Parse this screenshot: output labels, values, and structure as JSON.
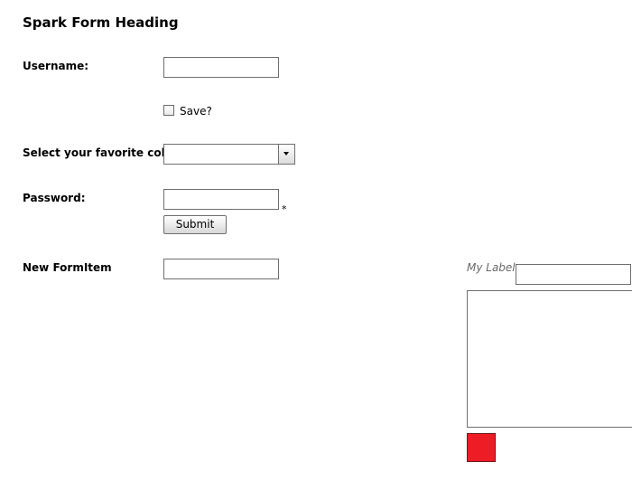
{
  "form": {
    "heading": "Spark Form Heading",
    "username": {
      "label": "Username:",
      "value": ""
    },
    "save_checkbox": {
      "label": "Save?",
      "checked": false
    },
    "favorite_color": {
      "label": "Select your favorite color",
      "selected": ""
    },
    "password": {
      "label": "Password:",
      "value": "",
      "required_marker": "*"
    },
    "submit_label": "Submit",
    "new_form_item": {
      "label": "New FormItem",
      "value": ""
    }
  },
  "side_panel": {
    "my_label": "My Label",
    "label_input_value": "",
    "textarea_value": "",
    "swatch_color": "#ee1c25"
  }
}
